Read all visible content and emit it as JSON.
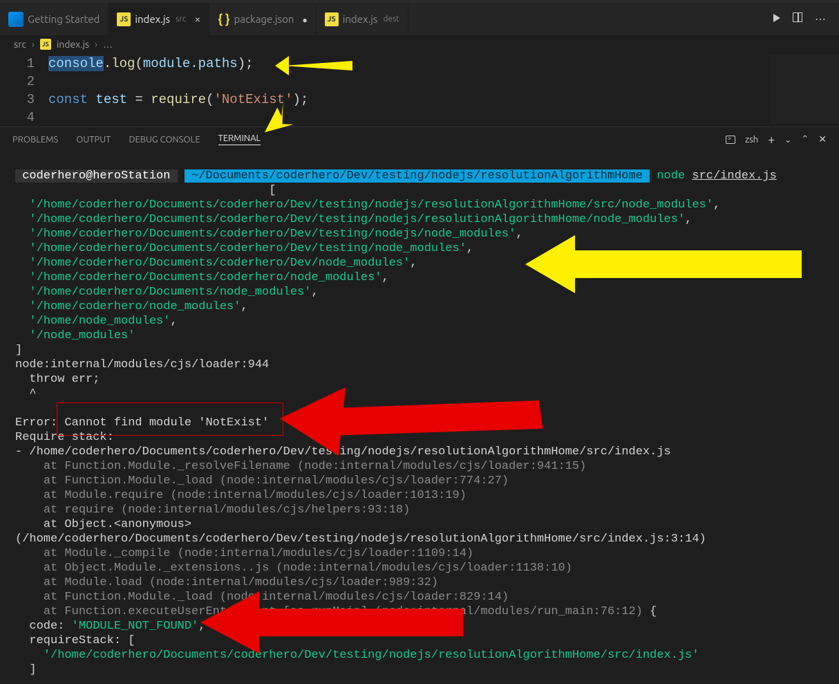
{
  "tabs": {
    "gettingStarted": "Getting Started",
    "indexSrc": "index.js",
    "indexSrcSub": "src",
    "packageJson": "package.json",
    "indexDest": "index.js",
    "indexDestSub": "dest"
  },
  "breadcrumbs": {
    "root": "src",
    "file": "index.js",
    "more": "…"
  },
  "editor": {
    "l1_console": "console",
    "l1_log": ".log",
    "l1_open": "(",
    "l1_module": "module",
    "l1_paths": ".paths",
    "l1_close": ");",
    "l3_const": "const",
    "l3_test": " test ",
    "l3_eq": "= ",
    "l3_require": "require",
    "l3_open": "(",
    "l3_str": "'NotExist'",
    "l3_close": ");"
  },
  "lineNums": {
    "n1": "1",
    "n2": "2",
    "n3": "3",
    "n4": "4"
  },
  "panelTabs": {
    "problems": "PROBLEMS",
    "output": "OUTPUT",
    "debug": "DEBUG CONSOLE",
    "terminal": "TERMINAL"
  },
  "panelRight": {
    "shell": "zsh"
  },
  "terminal": {
    "prompt_user": " coderhero@heroStation ",
    "prompt_path": " ~/Documents/coderhero/Dev/testing/nodejs/resolutionAlgorithmHome ",
    "prompt_cmd": "node ",
    "prompt_arg": "src/index.js",
    "bracket_open": "[",
    "paths": [
      "'/home/coderhero/Documents/coderhero/Dev/testing/nodejs/resolutionAlgorithmHome/src/node_modules'",
      "'/home/coderhero/Documents/coderhero/Dev/testing/nodejs/resolutionAlgorithmHome/node_modules'",
      "'/home/coderhero/Documents/coderhero/Dev/testing/nodejs/node_modules'",
      "'/home/coderhero/Documents/coderhero/Dev/testing/node_modules'",
      "'/home/coderhero/Documents/coderhero/Dev/node_modules'",
      "'/home/coderhero/Documents/coderhero/node_modules'",
      "'/home/coderhero/Documents/node_modules'",
      "'/home/coderhero/node_modules'",
      "'/home/node_modules'",
      "'/node_modules'"
    ],
    "bracket_close": "]",
    "loader": "node:internal/modules/cjs/loader:944",
    "throw": "  throw err;",
    "caret": "  ^",
    "error_pre": "Error:",
    "error_msg": " Cannot find module 'NotExist'",
    "reqstack": "Require stack:",
    "stack_file": "- /home/coderhero/Documents/coderhero/Dev/testing/nodejs/resolutionAlgorithmHome/src/index.js",
    "trace": [
      "    at Function.Module._resolveFilename (node:internal/modules/cjs/loader:941:15)",
      "    at Function.Module._load (node:internal/modules/cjs/loader:774:27)",
      "    at Module.require (node:internal/modules/cjs/loader:1013:19)",
      "    at require (node:internal/modules/cjs/helpers:93:18)"
    ],
    "trace_white": "    at Object.<anonymous> (/home/coderhero/Documents/coderhero/Dev/testing/nodejs/resolutionAlgorithmHome/src/index.js:3:14)",
    "trace2": [
      "    at Module._compile (node:internal/modules/cjs/loader:1109:14)",
      "    at Object.Module._extensions..js (node:internal/modules/cjs/loader:1138:10)",
      "    at Module.load (node:internal/modules/cjs/loader:989:32)",
      "    at Function.Module._load (node:internal/modules/cjs/loader:829:14)"
    ],
    "trace_last_g": "    at Function.executeUserEntryPoint [as runMain] (node:internal/modules/run_main:76:12) ",
    "trace_last_brace": "{",
    "code_key": "  code: ",
    "code_val": "'MODULE_NOT_FOUND'",
    "code_comma": ",",
    "reqstack_key": "  requireStack: [",
    "reqstack_val": "    '/home/coderhero/Documents/coderhero/Dev/testing/nodejs/resolutionAlgorithmHome/src/index.js'",
    "reqstack_close": "  ]"
  }
}
